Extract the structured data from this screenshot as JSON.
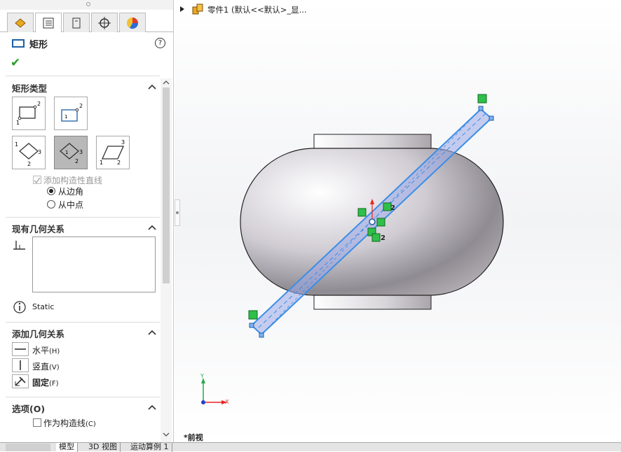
{
  "tree": {
    "part_label": "零件1 (默认<<默认>_显..."
  },
  "panel": {
    "title": "矩形",
    "help_label": "?",
    "sections": {
      "rect_type": "矩形类型",
      "existing_relations": "现有几何关系",
      "add_relations": "添加几何关系",
      "options": "选项(O)"
    },
    "add_construction": "添加构造性直线",
    "from_corner": "从边角",
    "from_center": "从中点",
    "status_text": "Static",
    "relations": [
      {
        "label": "水平",
        "key": "(H)"
      },
      {
        "label": "竖直",
        "key": "(V)"
      },
      {
        "label": "固定",
        "key": "(F)"
      }
    ],
    "as_construction": "作为构造线",
    "as_construction_key": "(C)"
  },
  "bottom_tabs": [
    "模型",
    "3D 视图",
    "运动算例 1"
  ],
  "viewport": {
    "view_label": "*前视",
    "axis_y": "Y",
    "axis_x": "X",
    "dim_label_1": "2",
    "dim_label_2": "2"
  },
  "colors": {
    "sketch": "#3b8ee6",
    "accent": "#1d5fa5",
    "ok": "#2a9b26"
  }
}
